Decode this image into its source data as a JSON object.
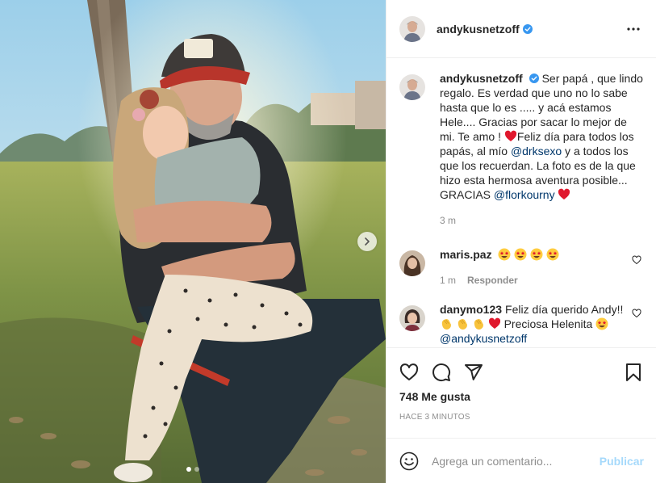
{
  "post": {
    "username": "andykusnetzoff",
    "verified": true,
    "accent_color": "#0095f6",
    "mention_color": "#00376b"
  },
  "caption": {
    "username": "andykusnetzoff",
    "text_1": "Ser papá , que lindo regalo. Es verdad que uno no lo sabe hasta que lo es ..... y acá estamos Hele.... Gracias por sacar lo mejor de mi. Te amo ! ",
    "text_2": "Feliz día para todos los papás, al mío ",
    "mention_1": "@drksexo",
    "text_3": " y a todos los que los recuerdan. La foto es de la que hizo esta hermosa aventura posible... GRACIAS ",
    "mention_2": "@florkourny",
    "time": "3 m"
  },
  "comments": [
    {
      "username": "maris.paz",
      "emojis": [
        "star-struck-emoji",
        "star-struck-emoji",
        "star-struck-emoji",
        "star-struck-emoji"
      ],
      "time": "1 m",
      "reply_label": "Responder"
    },
    {
      "username": "danymo123",
      "text_1": "Feliz día querido Andy!! ",
      "text_2": " Preciosa Helenita ",
      "mention": "@andykusnetzoff",
      "emojis": [
        "clapping-hands-emoji",
        "clapping-hands-emoji",
        "clapping-hands-emoji",
        "red-heart-emoji",
        "star-struck-emoji"
      ]
    }
  ],
  "actions": {
    "likes": "748 Me gusta",
    "timestamp": "HACE 3 MINUTOS"
  },
  "add_comment": {
    "placeholder": "Agrega un comentario...",
    "publish_label": "Publicar"
  },
  "carousel": {
    "slide_count": 2,
    "active_index": 0
  },
  "icons": [
    "more-icon",
    "verified-icon",
    "heart-icon",
    "comment-icon",
    "share-icon",
    "bookmark-icon",
    "smile-icon",
    "next-arrow-icon"
  ]
}
